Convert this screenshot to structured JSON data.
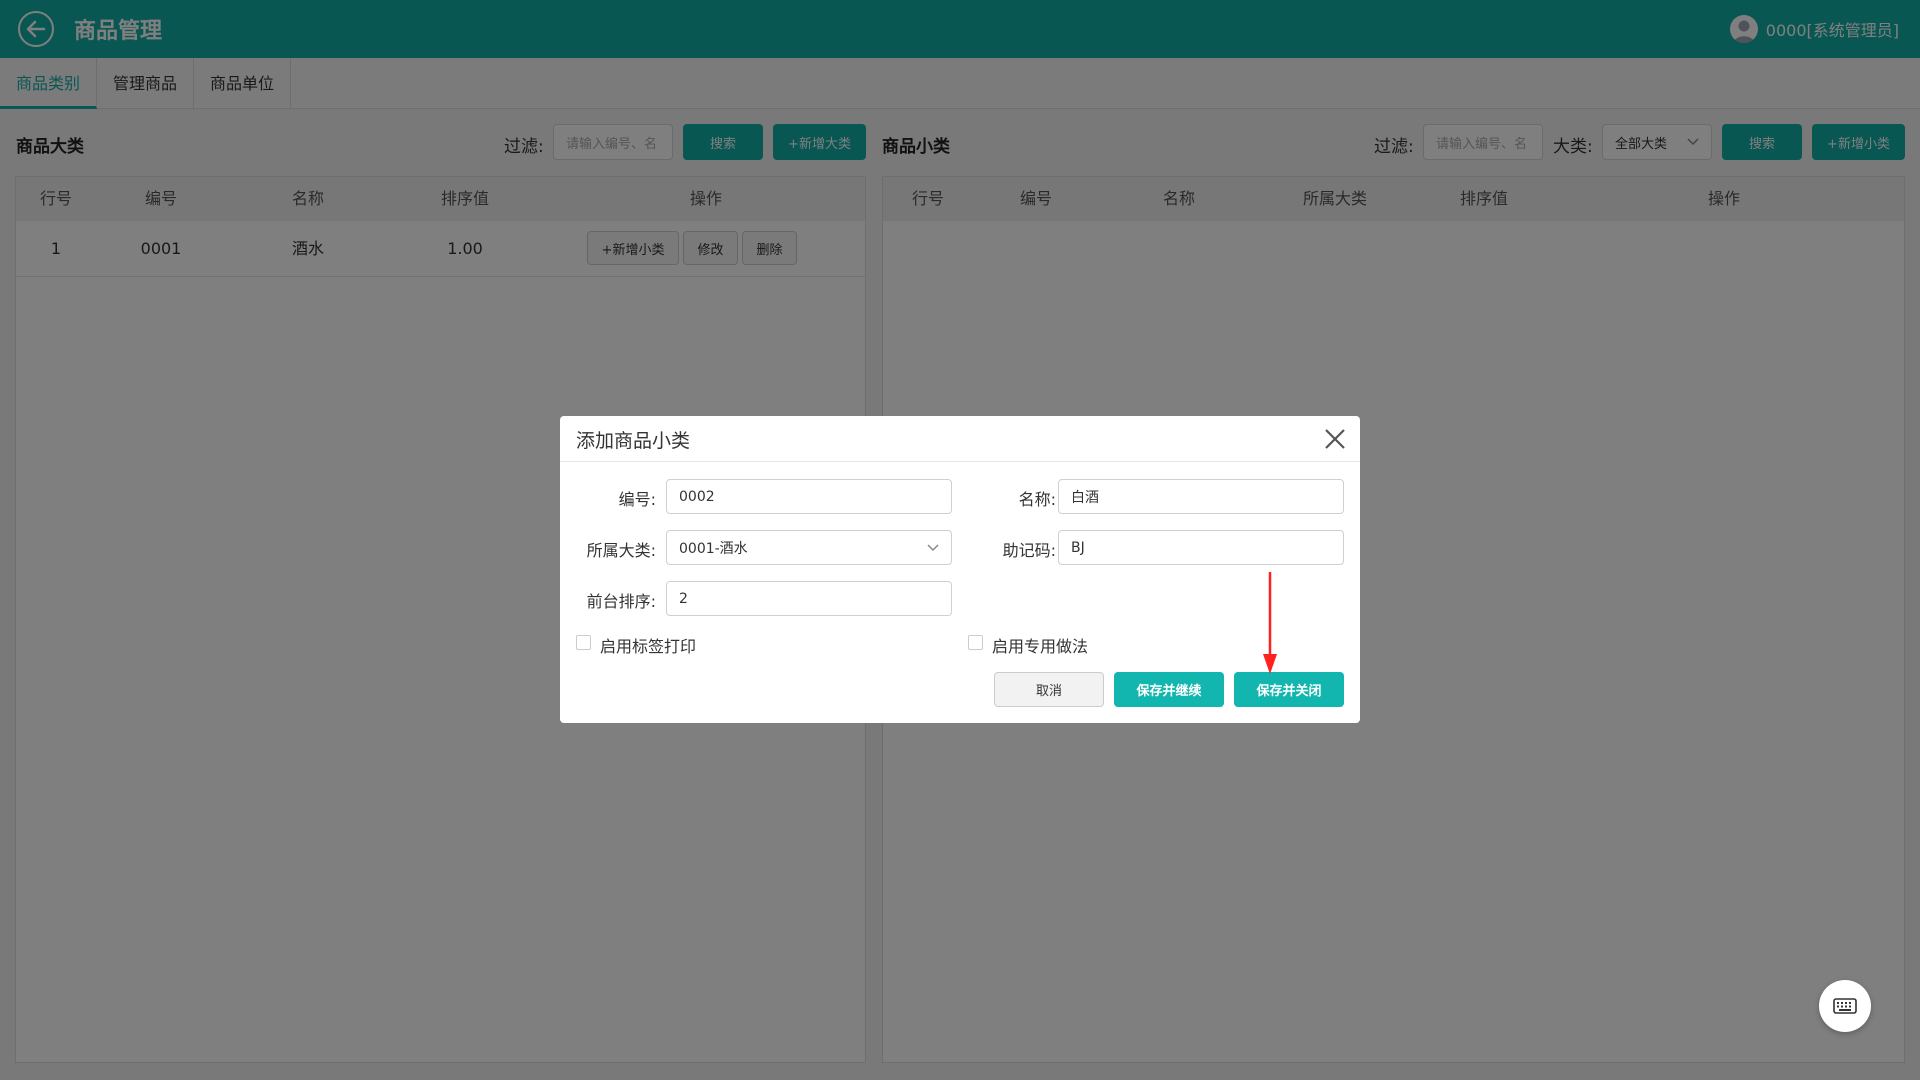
{
  "header": {
    "title": "商品管理",
    "user": "0000[系统管理员]"
  },
  "tabs": [
    {
      "label": "商品类别",
      "active": true
    },
    {
      "label": "管理商品",
      "active": false
    },
    {
      "label": "商品单位",
      "active": false
    }
  ],
  "left_panel": {
    "title": "商品大类",
    "filter_label": "过滤:",
    "filter_placeholder": "请输入编号、名",
    "search_label": "搜索",
    "add_label": "+新增大类",
    "columns": [
      "行号",
      "编号",
      "名称",
      "排序值",
      "操作"
    ],
    "rows": [
      {
        "index": "1",
        "code": "0001",
        "name": "酒水",
        "sort": "1.00"
      }
    ],
    "row_actions": [
      "+新增小类",
      "修改",
      "删除"
    ]
  },
  "right_panel": {
    "title": "商品小类",
    "filter_label": "过滤:",
    "filter_placeholder": "请输入编号、名",
    "category_label": "大类:",
    "category_value": "全部大类",
    "search_label": "搜索",
    "add_label": "+新增小类",
    "columns": [
      "行号",
      "编号",
      "名称",
      "所属大类",
      "排序值",
      "操作"
    ]
  },
  "modal": {
    "title": "添加商品小类",
    "code_label": "编号:",
    "code_value": "0002",
    "name_label": "名称:",
    "name_value": "白酒",
    "parent_label": "所属大类:",
    "parent_value": "0001-酒水",
    "mnemonic_label": "助记码:",
    "mnemonic_value": "BJ",
    "order_label": "前台排序:",
    "order_value": "2",
    "label_print": "启用标签打印",
    "special_method": "启用专用做法",
    "cancel": "取消",
    "save_continue": "保存并继续",
    "save_close": "保存并关闭"
  },
  "colors": {
    "accent": "#12aea6",
    "overlay": "rgba(0,0,0,0.5)",
    "arrow": "#ff2020"
  },
  "icons": {
    "back": "back-arrow-icon",
    "user": "user-avatar-icon",
    "close": "close-icon",
    "dropdown": "chevron-down-icon",
    "keyboard": "keyboard-icon"
  }
}
